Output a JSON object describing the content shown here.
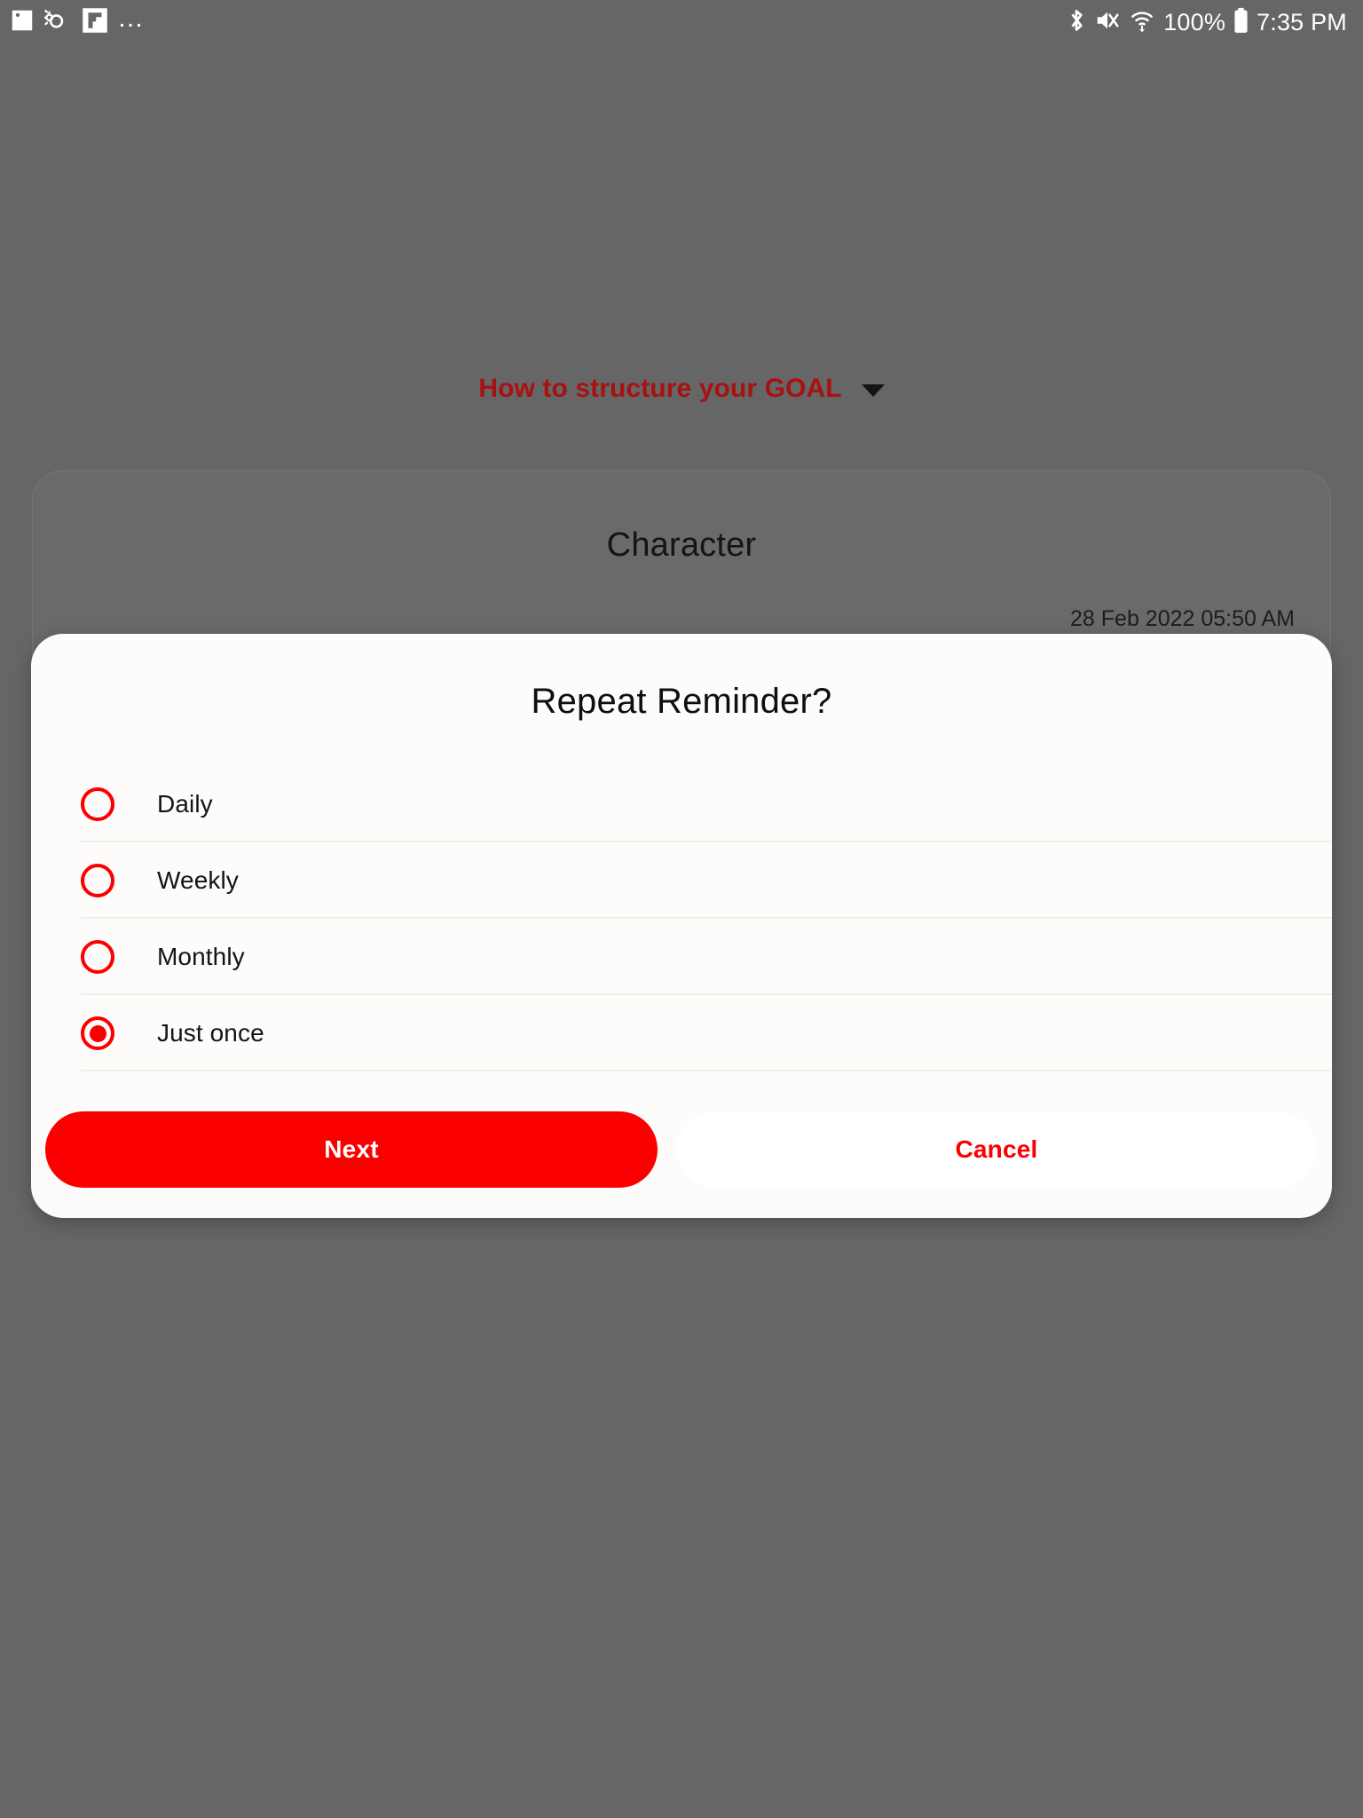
{
  "status_bar": {
    "left_icons": [
      {
        "name": "image-icon",
        "glyph": "picture"
      },
      {
        "name": "weather-icon",
        "glyph": "sun-cloud"
      },
      {
        "name": "app-icon",
        "glyph": "flag-square"
      },
      {
        "name": "more-icon",
        "glyph": "…"
      }
    ],
    "right_icons": [
      {
        "name": "bluetooth-icon"
      },
      {
        "name": "mute-icon"
      },
      {
        "name": "wifi-icon"
      },
      {
        "name": "battery-icon"
      }
    ],
    "battery_percent": "100%",
    "clock": "7:35 PM"
  },
  "header": {
    "goal_link_label": "How to structure your GOAL",
    "goal_link_color": "#a81111",
    "caret_icon": "chevron-down-icon"
  },
  "card": {
    "title": "Character",
    "timestamp": "28 Feb 2022 05:50 AM"
  },
  "dialog": {
    "title": "Repeat Reminder?",
    "options": [
      {
        "label": "Daily",
        "selected": false
      },
      {
        "label": "Weekly",
        "selected": false
      },
      {
        "label": "Monthly",
        "selected": false
      },
      {
        "label": "Just once",
        "selected": true
      }
    ],
    "selected_option": "Just once",
    "primary_button_label": "Next",
    "secondary_button_label": "Cancel",
    "accent_color": "#fa0000",
    "surface_color": "#fdfcfa"
  },
  "theme": {
    "scrim_color": "#666666",
    "accent_red": "#fa0000",
    "dark_red": "#a81111"
  }
}
